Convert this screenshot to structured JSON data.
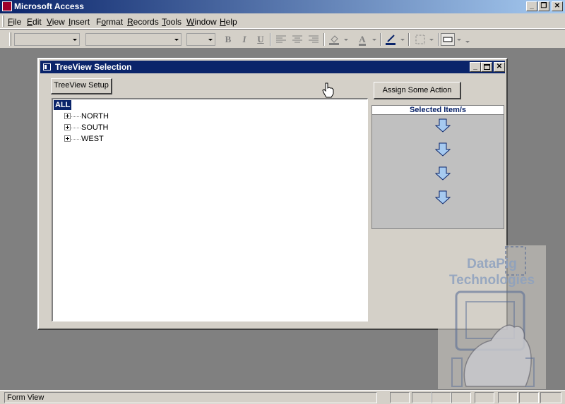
{
  "app": {
    "title": "Microsoft Access"
  },
  "window_controls": {
    "minimize": "_",
    "restore": "❐",
    "close": "✕"
  },
  "menu": [
    {
      "label": "File",
      "underline": "F"
    },
    {
      "label": "Edit",
      "underline": "E"
    },
    {
      "label": "View",
      "underline": "V"
    },
    {
      "label": "Insert",
      "underline": "I"
    },
    {
      "label": "Format",
      "underline": "o"
    },
    {
      "label": "Records",
      "underline": "R"
    },
    {
      "label": "Tools",
      "underline": "T"
    },
    {
      "label": "Window",
      "underline": "W"
    },
    {
      "label": "Help",
      "underline": "H"
    }
  ],
  "toolbar": {
    "bold": "B",
    "italic": "I",
    "underline": "U",
    "font_color": "A",
    "icons": [
      "align-left-icon",
      "align-center-icon",
      "align-right-icon",
      "fill-color-icon",
      "font-color-icon",
      "line-color-icon",
      "border-icon",
      "special-effect-icon"
    ]
  },
  "form": {
    "title": "TreeView Selection",
    "treeview_setup_label": "TreeView Setup",
    "assign_action_label": "Assign Some Action",
    "tree": {
      "root": "ALL",
      "nodes": [
        "NORTH",
        "SOUTH",
        "WEST"
      ]
    },
    "selected_header": "Selected Item/s",
    "down_arrows": 4
  },
  "watermark": {
    "line1": "DataPig",
    "line2": "Technologies"
  },
  "status": {
    "text": "Form View"
  },
  "colors": {
    "title_bar": "#0a246a",
    "face": "#d4d0c8",
    "workspace": "#808080",
    "arrow_fill": "#a6caf0"
  }
}
